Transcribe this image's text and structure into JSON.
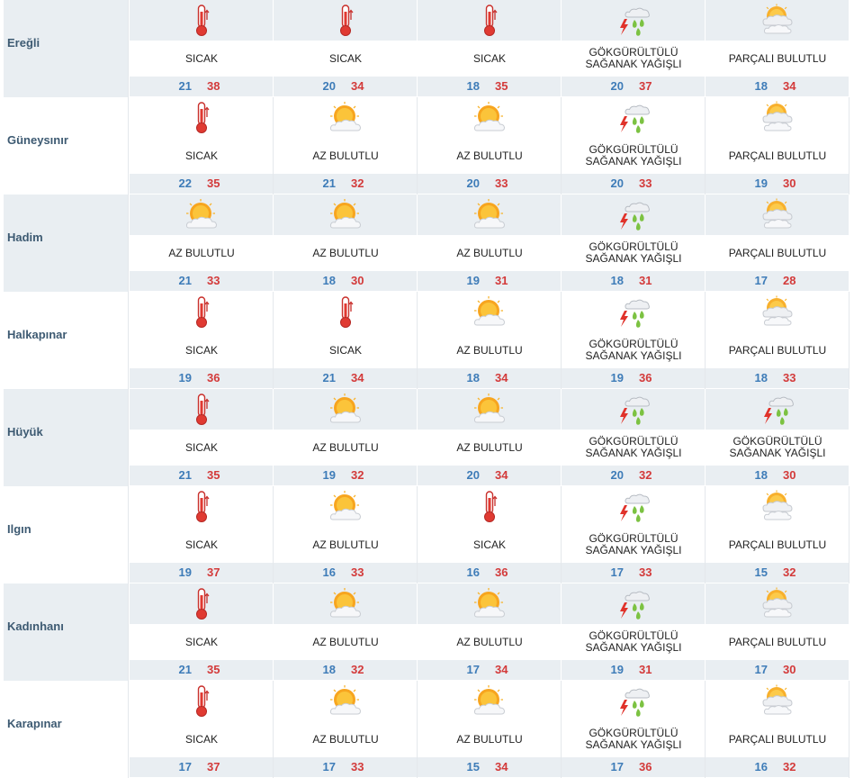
{
  "colors": {
    "min": "#3e7cb8",
    "max": "#d33a3a",
    "row_shade": "#e9eef2",
    "city": "#3d5a72"
  },
  "cities": [
    {
      "name": "Ereğli",
      "days": [
        {
          "icon": "thermometer-icon",
          "cond": [
            "SICAK"
          ],
          "min": "21",
          "max": "38"
        },
        {
          "icon": "thermometer-icon",
          "cond": [
            "SICAK"
          ],
          "min": "20",
          "max": "34"
        },
        {
          "icon": "thermometer-icon",
          "cond": [
            "SICAK"
          ],
          "min": "18",
          "max": "35"
        },
        {
          "icon": "thunderstorm-icon",
          "cond": [
            "GÖKGÜRÜLTÜLÜ",
            "SAĞANAK YAĞIŞLI"
          ],
          "min": "20",
          "max": "37"
        },
        {
          "icon": "partly-cloudy-icon",
          "cond": [
            "PARÇALI BULUTLU"
          ],
          "min": "18",
          "max": "34"
        }
      ]
    },
    {
      "name": "Güneysınır",
      "days": [
        {
          "icon": "thermometer-icon",
          "cond": [
            "SICAK"
          ],
          "min": "22",
          "max": "35"
        },
        {
          "icon": "sun-cloud-icon",
          "cond": [
            "AZ BULUTLU"
          ],
          "min": "21",
          "max": "32"
        },
        {
          "icon": "sun-cloud-icon",
          "cond": [
            "AZ BULUTLU"
          ],
          "min": "20",
          "max": "33"
        },
        {
          "icon": "thunderstorm-icon",
          "cond": [
            "GÖKGÜRÜLTÜLÜ",
            "SAĞANAK YAĞIŞLI"
          ],
          "min": "20",
          "max": "33"
        },
        {
          "icon": "partly-cloudy-icon",
          "cond": [
            "PARÇALI BULUTLU"
          ],
          "min": "19",
          "max": "30"
        }
      ]
    },
    {
      "name": "Hadim",
      "days": [
        {
          "icon": "sun-cloud-icon",
          "cond": [
            "AZ BULUTLU"
          ],
          "min": "21",
          "max": "33"
        },
        {
          "icon": "sun-cloud-icon",
          "cond": [
            "AZ BULUTLU"
          ],
          "min": "18",
          "max": "30"
        },
        {
          "icon": "sun-cloud-icon",
          "cond": [
            "AZ BULUTLU"
          ],
          "min": "19",
          "max": "31"
        },
        {
          "icon": "thunderstorm-icon",
          "cond": [
            "GÖKGÜRÜLTÜLÜ",
            "SAĞANAK YAĞIŞLI"
          ],
          "min": "18",
          "max": "31"
        },
        {
          "icon": "partly-cloudy-icon",
          "cond": [
            "PARÇALI BULUTLU"
          ],
          "min": "17",
          "max": "28"
        }
      ]
    },
    {
      "name": "Halkapınar",
      "days": [
        {
          "icon": "thermometer-icon",
          "cond": [
            "SICAK"
          ],
          "min": "19",
          "max": "36"
        },
        {
          "icon": "thermometer-icon",
          "cond": [
            "SICAK"
          ],
          "min": "21",
          "max": "34"
        },
        {
          "icon": "sun-cloud-icon",
          "cond": [
            "AZ BULUTLU"
          ],
          "min": "18",
          "max": "34"
        },
        {
          "icon": "thunderstorm-icon",
          "cond": [
            "GÖKGÜRÜLTÜLÜ",
            "SAĞANAK YAĞIŞLI"
          ],
          "min": "19",
          "max": "36"
        },
        {
          "icon": "partly-cloudy-icon",
          "cond": [
            "PARÇALI BULUTLU"
          ],
          "min": "18",
          "max": "33"
        }
      ]
    },
    {
      "name": "Hüyük",
      "days": [
        {
          "icon": "thermometer-icon",
          "cond": [
            "SICAK"
          ],
          "min": "21",
          "max": "35"
        },
        {
          "icon": "sun-cloud-icon",
          "cond": [
            "AZ BULUTLU"
          ],
          "min": "19",
          "max": "32"
        },
        {
          "icon": "sun-cloud-icon",
          "cond": [
            "AZ BULUTLU"
          ],
          "min": "20",
          "max": "34"
        },
        {
          "icon": "thunderstorm-icon",
          "cond": [
            "GÖKGÜRÜLTÜLÜ",
            "SAĞANAK YAĞIŞLI"
          ],
          "min": "20",
          "max": "32"
        },
        {
          "icon": "thunderstorm-icon",
          "cond": [
            "GÖKGÜRÜLTÜLÜ",
            "SAĞANAK YAĞIŞLI"
          ],
          "min": "18",
          "max": "30"
        }
      ]
    },
    {
      "name": "Ilgın",
      "days": [
        {
          "icon": "thermometer-icon",
          "cond": [
            "SICAK"
          ],
          "min": "19",
          "max": "37"
        },
        {
          "icon": "sun-cloud-icon",
          "cond": [
            "AZ BULUTLU"
          ],
          "min": "16",
          "max": "33"
        },
        {
          "icon": "thermometer-icon",
          "cond": [
            "SICAK"
          ],
          "min": "16",
          "max": "36"
        },
        {
          "icon": "thunderstorm-icon",
          "cond": [
            "GÖKGÜRÜLTÜLÜ",
            "SAĞANAK YAĞIŞLI"
          ],
          "min": "17",
          "max": "33"
        },
        {
          "icon": "partly-cloudy-icon",
          "cond": [
            "PARÇALI BULUTLU"
          ],
          "min": "15",
          "max": "32"
        }
      ]
    },
    {
      "name": "Kadınhanı",
      "days": [
        {
          "icon": "thermometer-icon",
          "cond": [
            "SICAK"
          ],
          "min": "21",
          "max": "35"
        },
        {
          "icon": "sun-cloud-icon",
          "cond": [
            "AZ BULUTLU"
          ],
          "min": "18",
          "max": "32"
        },
        {
          "icon": "sun-cloud-icon",
          "cond": [
            "AZ BULUTLU"
          ],
          "min": "17",
          "max": "34"
        },
        {
          "icon": "thunderstorm-icon",
          "cond": [
            "GÖKGÜRÜLTÜLÜ",
            "SAĞANAK YAĞIŞLI"
          ],
          "min": "19",
          "max": "31"
        },
        {
          "icon": "partly-cloudy-icon",
          "cond": [
            "PARÇALI BULUTLU"
          ],
          "min": "17",
          "max": "30"
        }
      ]
    },
    {
      "name": "Karapınar",
      "days": [
        {
          "icon": "thermometer-icon",
          "cond": [
            "SICAK"
          ],
          "min": "17",
          "max": "37"
        },
        {
          "icon": "sun-cloud-icon",
          "cond": [
            "AZ BULUTLU"
          ],
          "min": "17",
          "max": "33"
        },
        {
          "icon": "sun-cloud-icon",
          "cond": [
            "AZ BULUTLU"
          ],
          "min": "15",
          "max": "34"
        },
        {
          "icon": "thunderstorm-icon",
          "cond": [
            "GÖKGÜRÜLTÜLÜ",
            "SAĞANAK YAĞIŞLI"
          ],
          "min": "17",
          "max": "36"
        },
        {
          "icon": "partly-cloudy-icon",
          "cond": [
            "PARÇALI BULUTLU"
          ],
          "min": "16",
          "max": "32"
        }
      ]
    }
  ]
}
